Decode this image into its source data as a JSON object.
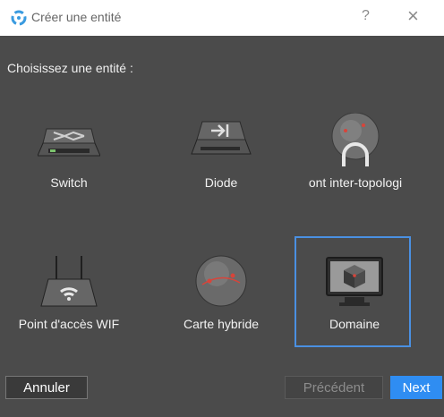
{
  "window": {
    "title": "Créer une entité",
    "help_label": "?",
    "close_label": "×"
  },
  "content": {
    "prompt": "Choisissez une entité :",
    "entities": [
      {
        "label": "Switch",
        "icon": "switch-icon",
        "selected": false
      },
      {
        "label": "Diode",
        "icon": "diode-icon",
        "selected": false
      },
      {
        "label": "ont inter-topologi",
        "icon": "inter-topology-bridge-icon",
        "selected": false
      },
      {
        "label": "Point d'accès WIF",
        "icon": "wifi-access-point-icon",
        "selected": false
      },
      {
        "label": "Carte hybride",
        "icon": "hybrid-map-icon",
        "selected": false
      },
      {
        "label": "Domaine",
        "icon": "domain-icon",
        "selected": true
      }
    ]
  },
  "buttons": {
    "cancel": "Annuler",
    "previous": "Précédent",
    "next": "Next"
  },
  "colors": {
    "background": "#4b4b4b",
    "accent": "#2f8df2",
    "selection_border": "#4a90e2",
    "marker_red": "#d8443a"
  }
}
